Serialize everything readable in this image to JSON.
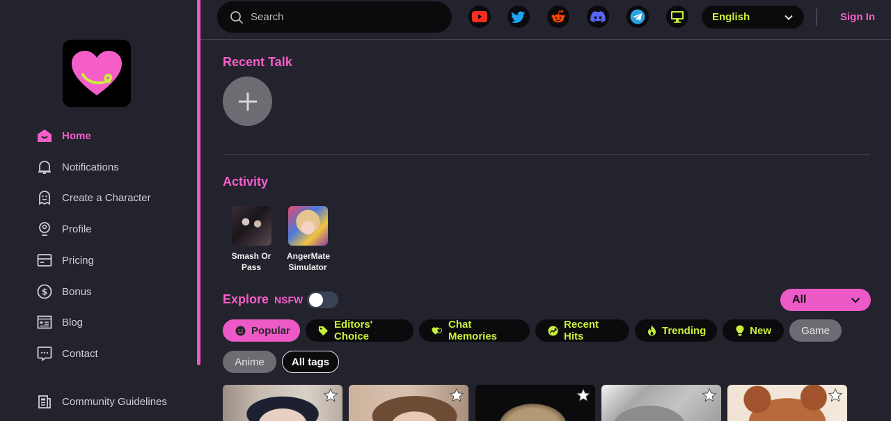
{
  "sidebar": {
    "items": [
      {
        "label": "Home",
        "icon": "home-icon"
      },
      {
        "label": "Notifications",
        "icon": "bell-icon"
      },
      {
        "label": "Create a Character",
        "icon": "ghost-icon"
      },
      {
        "label": "Profile",
        "icon": "profile-icon"
      },
      {
        "label": "Pricing",
        "icon": "card-icon"
      },
      {
        "label": "Bonus",
        "icon": "dollar-icon"
      },
      {
        "label": "Blog",
        "icon": "blog-icon"
      },
      {
        "label": "Contact",
        "icon": "chat-icon"
      },
      {
        "label": "Community Guidelines",
        "icon": "guidelines-icon"
      }
    ]
  },
  "topbar": {
    "search_placeholder": "Search",
    "socials": [
      "youtube-icon",
      "twitter-icon",
      "reddit-icon",
      "discord-icon",
      "telegram-icon",
      "desktop-icon"
    ],
    "language": "English",
    "signin": "Sign In"
  },
  "main": {
    "recent_talk_title": "Recent Talk",
    "activity_title": "Activity",
    "activity": [
      {
        "name_line1": "Smash Or",
        "name_line2": "Pass"
      },
      {
        "name_line1": "AngerMate",
        "name_line2": "Simulator"
      }
    ],
    "explore_title": "Explore",
    "nsfw_label": "NSFW",
    "nsfw_on": false,
    "category_select": "All",
    "chips": [
      {
        "label": "Popular",
        "icon": "smile-icon",
        "state": "active"
      },
      {
        "label": "Editors' Choice",
        "icon": "tag-icon",
        "state": "default"
      },
      {
        "label": "Chat Memories",
        "icon": "hearts-icon",
        "state": "default"
      },
      {
        "label": "Recent Hits",
        "icon": "trend-icon",
        "state": "default"
      },
      {
        "label": "Trending",
        "icon": "fire-icon",
        "state": "default"
      },
      {
        "label": "New",
        "icon": "bulb-icon",
        "state": "default"
      },
      {
        "label": "Game",
        "icon": "",
        "state": "gray"
      },
      {
        "label": "Anime",
        "icon": "",
        "state": "gray"
      },
      {
        "label": "All tags",
        "icon": "",
        "state": "outline"
      }
    ]
  },
  "colors": {
    "accent_pink": "#ee59c8",
    "accent_lime": "#c9f03e",
    "background": "#23232d"
  }
}
